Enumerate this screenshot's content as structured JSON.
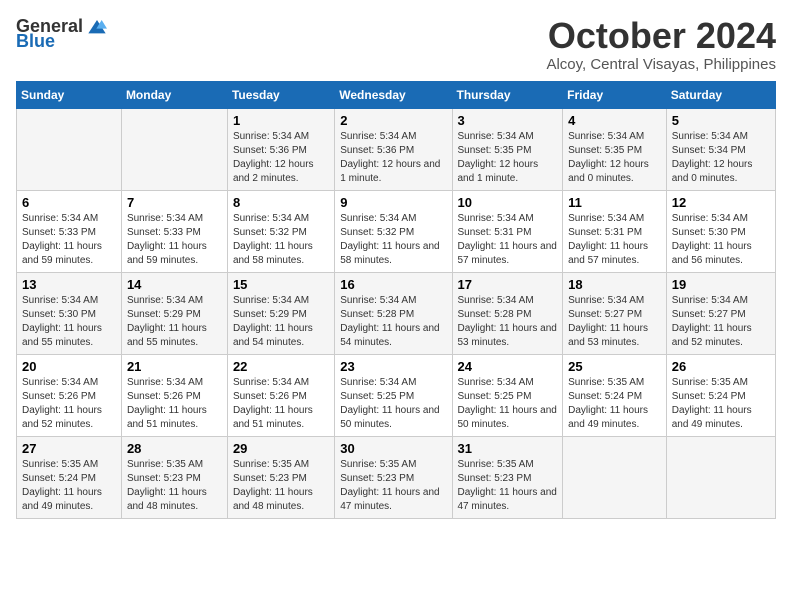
{
  "logo": {
    "general": "General",
    "blue": "Blue"
  },
  "header": {
    "month": "October 2024",
    "location": "Alcoy, Central Visayas, Philippines"
  },
  "days_of_week": [
    "Sunday",
    "Monday",
    "Tuesday",
    "Wednesday",
    "Thursday",
    "Friday",
    "Saturday"
  ],
  "weeks": [
    [
      {
        "day": "",
        "info": ""
      },
      {
        "day": "",
        "info": ""
      },
      {
        "day": "1",
        "info": "Sunrise: 5:34 AM\nSunset: 5:36 PM\nDaylight: 12 hours and 2 minutes."
      },
      {
        "day": "2",
        "info": "Sunrise: 5:34 AM\nSunset: 5:36 PM\nDaylight: 12 hours and 1 minute."
      },
      {
        "day": "3",
        "info": "Sunrise: 5:34 AM\nSunset: 5:35 PM\nDaylight: 12 hours and 1 minute."
      },
      {
        "day": "4",
        "info": "Sunrise: 5:34 AM\nSunset: 5:35 PM\nDaylight: 12 hours and 0 minutes."
      },
      {
        "day": "5",
        "info": "Sunrise: 5:34 AM\nSunset: 5:34 PM\nDaylight: 12 hours and 0 minutes."
      }
    ],
    [
      {
        "day": "6",
        "info": "Sunrise: 5:34 AM\nSunset: 5:33 PM\nDaylight: 11 hours and 59 minutes."
      },
      {
        "day": "7",
        "info": "Sunrise: 5:34 AM\nSunset: 5:33 PM\nDaylight: 11 hours and 59 minutes."
      },
      {
        "day": "8",
        "info": "Sunrise: 5:34 AM\nSunset: 5:32 PM\nDaylight: 11 hours and 58 minutes."
      },
      {
        "day": "9",
        "info": "Sunrise: 5:34 AM\nSunset: 5:32 PM\nDaylight: 11 hours and 58 minutes."
      },
      {
        "day": "10",
        "info": "Sunrise: 5:34 AM\nSunset: 5:31 PM\nDaylight: 11 hours and 57 minutes."
      },
      {
        "day": "11",
        "info": "Sunrise: 5:34 AM\nSunset: 5:31 PM\nDaylight: 11 hours and 57 minutes."
      },
      {
        "day": "12",
        "info": "Sunrise: 5:34 AM\nSunset: 5:30 PM\nDaylight: 11 hours and 56 minutes."
      }
    ],
    [
      {
        "day": "13",
        "info": "Sunrise: 5:34 AM\nSunset: 5:30 PM\nDaylight: 11 hours and 55 minutes."
      },
      {
        "day": "14",
        "info": "Sunrise: 5:34 AM\nSunset: 5:29 PM\nDaylight: 11 hours and 55 minutes."
      },
      {
        "day": "15",
        "info": "Sunrise: 5:34 AM\nSunset: 5:29 PM\nDaylight: 11 hours and 54 minutes."
      },
      {
        "day": "16",
        "info": "Sunrise: 5:34 AM\nSunset: 5:28 PM\nDaylight: 11 hours and 54 minutes."
      },
      {
        "day": "17",
        "info": "Sunrise: 5:34 AM\nSunset: 5:28 PM\nDaylight: 11 hours and 53 minutes."
      },
      {
        "day": "18",
        "info": "Sunrise: 5:34 AM\nSunset: 5:27 PM\nDaylight: 11 hours and 53 minutes."
      },
      {
        "day": "19",
        "info": "Sunrise: 5:34 AM\nSunset: 5:27 PM\nDaylight: 11 hours and 52 minutes."
      }
    ],
    [
      {
        "day": "20",
        "info": "Sunrise: 5:34 AM\nSunset: 5:26 PM\nDaylight: 11 hours and 52 minutes."
      },
      {
        "day": "21",
        "info": "Sunrise: 5:34 AM\nSunset: 5:26 PM\nDaylight: 11 hours and 51 minutes."
      },
      {
        "day": "22",
        "info": "Sunrise: 5:34 AM\nSunset: 5:26 PM\nDaylight: 11 hours and 51 minutes."
      },
      {
        "day": "23",
        "info": "Sunrise: 5:34 AM\nSunset: 5:25 PM\nDaylight: 11 hours and 50 minutes."
      },
      {
        "day": "24",
        "info": "Sunrise: 5:34 AM\nSunset: 5:25 PM\nDaylight: 11 hours and 50 minutes."
      },
      {
        "day": "25",
        "info": "Sunrise: 5:35 AM\nSunset: 5:24 PM\nDaylight: 11 hours and 49 minutes."
      },
      {
        "day": "26",
        "info": "Sunrise: 5:35 AM\nSunset: 5:24 PM\nDaylight: 11 hours and 49 minutes."
      }
    ],
    [
      {
        "day": "27",
        "info": "Sunrise: 5:35 AM\nSunset: 5:24 PM\nDaylight: 11 hours and 49 minutes."
      },
      {
        "day": "28",
        "info": "Sunrise: 5:35 AM\nSunset: 5:23 PM\nDaylight: 11 hours and 48 minutes."
      },
      {
        "day": "29",
        "info": "Sunrise: 5:35 AM\nSunset: 5:23 PM\nDaylight: 11 hours and 48 minutes."
      },
      {
        "day": "30",
        "info": "Sunrise: 5:35 AM\nSunset: 5:23 PM\nDaylight: 11 hours and 47 minutes."
      },
      {
        "day": "31",
        "info": "Sunrise: 5:35 AM\nSunset: 5:23 PM\nDaylight: 11 hours and 47 minutes."
      },
      {
        "day": "",
        "info": ""
      },
      {
        "day": "",
        "info": ""
      }
    ]
  ]
}
